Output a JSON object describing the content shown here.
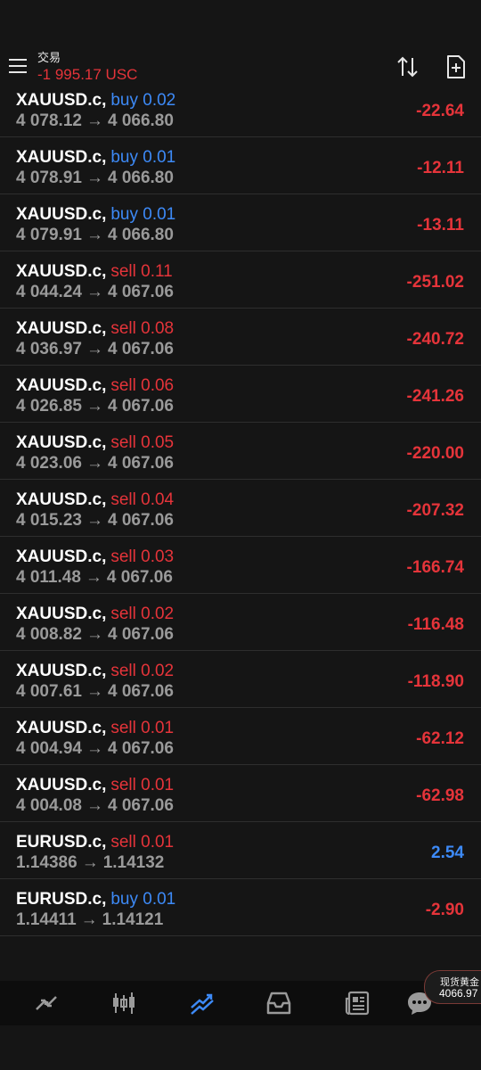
{
  "header": {
    "title": "交易",
    "balance": "-1 995.17 USC",
    "icons": [
      "menu-icon",
      "sort-icon",
      "new-order-icon"
    ]
  },
  "positions": [
    {
      "symbol": "XAUUSD.c,",
      "side": "buy",
      "side_text": "buy 0.02",
      "open": "4 078.12",
      "current": "4 066.80",
      "profit": "-22.64"
    },
    {
      "symbol": "XAUUSD.c,",
      "side": "buy",
      "side_text": "buy 0.01",
      "open": "4 078.91",
      "current": "4 066.80",
      "profit": "-12.11"
    },
    {
      "symbol": "XAUUSD.c,",
      "side": "buy",
      "side_text": "buy 0.01",
      "open": "4 079.91",
      "current": "4 066.80",
      "profit": "-13.11"
    },
    {
      "symbol": "XAUUSD.c,",
      "side": "sell",
      "side_text": "sell 0.11",
      "open": "4 044.24",
      "current": "4 067.06",
      "profit": "-251.02"
    },
    {
      "symbol": "XAUUSD.c,",
      "side": "sell",
      "side_text": "sell 0.08",
      "open": "4 036.97",
      "current": "4 067.06",
      "profit": "-240.72"
    },
    {
      "symbol": "XAUUSD.c,",
      "side": "sell",
      "side_text": "sell 0.06",
      "open": "4 026.85",
      "current": "4 067.06",
      "profit": "-241.26"
    },
    {
      "symbol": "XAUUSD.c,",
      "side": "sell",
      "side_text": "sell 0.05",
      "open": "4 023.06",
      "current": "4 067.06",
      "profit": "-220.00"
    },
    {
      "symbol": "XAUUSD.c,",
      "side": "sell",
      "side_text": "sell 0.04",
      "open": "4 015.23",
      "current": "4 067.06",
      "profit": "-207.32"
    },
    {
      "symbol": "XAUUSD.c,",
      "side": "sell",
      "side_text": "sell 0.03",
      "open": "4 011.48",
      "current": "4 067.06",
      "profit": "-166.74"
    },
    {
      "symbol": "XAUUSD.c,",
      "side": "sell",
      "side_text": "sell 0.02",
      "open": "4 008.82",
      "current": "4 067.06",
      "profit": "-116.48"
    },
    {
      "symbol": "XAUUSD.c,",
      "side": "sell",
      "side_text": "sell 0.02",
      "open": "4 007.61",
      "current": "4 067.06",
      "profit": "-118.90"
    },
    {
      "symbol": "XAUUSD.c,",
      "side": "sell",
      "side_text": "sell 0.01",
      "open": "4 004.94",
      "current": "4 067.06",
      "profit": "-62.12"
    },
    {
      "symbol": "XAUUSD.c,",
      "side": "sell",
      "side_text": "sell 0.01",
      "open": "4 004.08",
      "current": "4 067.06",
      "profit": "-62.98"
    },
    {
      "symbol": "EURUSD.c,",
      "side": "sell",
      "side_text": "sell 0.01",
      "open": "1.14386",
      "current": "1.14132",
      "profit": "2.54"
    },
    {
      "symbol": "EURUSD.c,",
      "side": "buy",
      "side_text": "buy 0.01",
      "open": "1.14411",
      "current": "1.14121",
      "profit": "-2.90"
    }
  ],
  "arrow": "→",
  "bottom_nav": [
    {
      "icon": "quotes-icon",
      "active": false
    },
    {
      "icon": "chart-icon",
      "active": false
    },
    {
      "icon": "trade-icon",
      "active": true
    },
    {
      "icon": "history-icon",
      "active": false
    },
    {
      "icon": "news-icon",
      "active": false
    },
    {
      "icon": "chat-icon",
      "active": false
    }
  ],
  "floating_ticker": {
    "title": "现货黄金",
    "price": "4066.97"
  },
  "colors": {
    "background": "#151515",
    "buy": "#3d8af7",
    "sell": "#e5343a",
    "profit_negative": "#e5343a",
    "profit_positive": "#3d8af7",
    "active_nav": "#3d8af7"
  }
}
